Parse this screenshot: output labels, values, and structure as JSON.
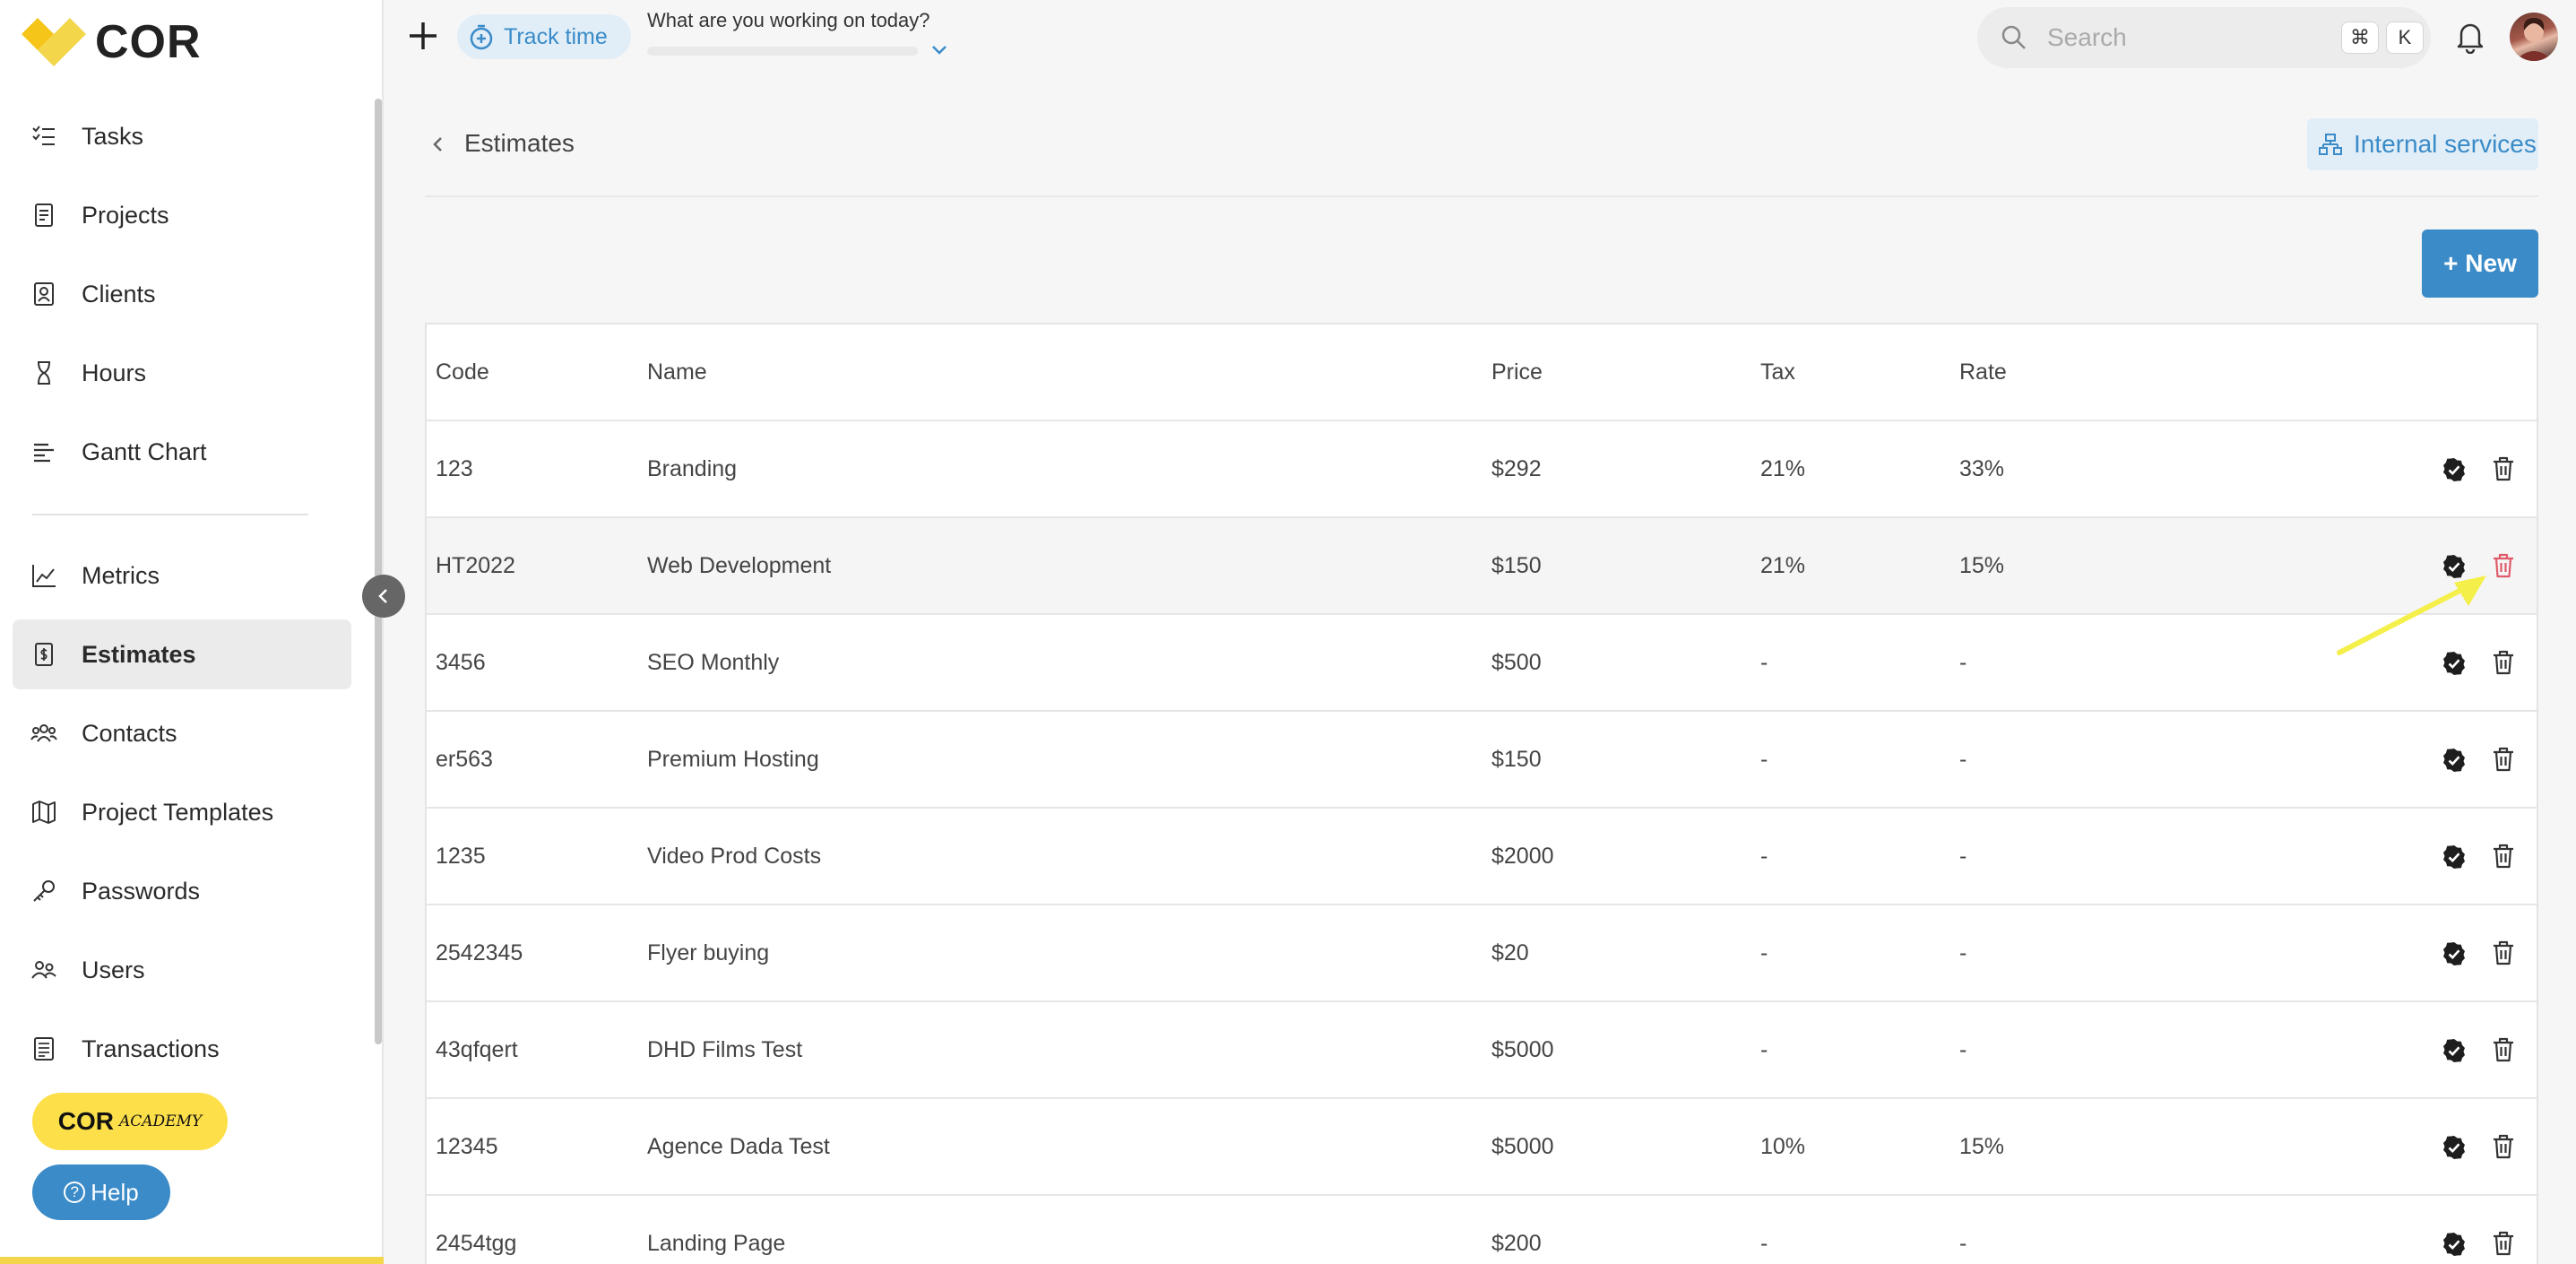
{
  "brand": {
    "logo_text": "COR"
  },
  "sidebar": {
    "items": [
      {
        "label": "Tasks",
        "icon": "tasks-icon"
      },
      {
        "label": "Projects",
        "icon": "projects-icon"
      },
      {
        "label": "Clients",
        "icon": "clients-icon"
      },
      {
        "label": "Hours",
        "icon": "hourglass-icon"
      },
      {
        "label": "Gantt Chart",
        "icon": "gantt-icon"
      },
      {
        "label": "Metrics",
        "icon": "metrics-icon"
      },
      {
        "label": "Estimates",
        "icon": "estimates-icon",
        "active": true
      },
      {
        "label": "Contacts",
        "icon": "contacts-icon"
      },
      {
        "label": "Project Templates",
        "icon": "map-icon"
      },
      {
        "label": "Passwords",
        "icon": "key-icon"
      },
      {
        "label": "Users",
        "icon": "users-icon"
      },
      {
        "label": "Transactions",
        "icon": "transactions-icon"
      }
    ],
    "academy": {
      "main": "COR",
      "sub": "ACADEMY"
    },
    "help_label": "Help"
  },
  "topbar": {
    "track_time_label": "Track time",
    "working_prompt": "What are you working on today?",
    "search_placeholder": "Search",
    "shortcut_keys": [
      "⌘",
      "K"
    ]
  },
  "page": {
    "title": "Estimates",
    "internal_services_label": "Internal services",
    "new_button_label": "+ New"
  },
  "table": {
    "columns": [
      "Code",
      "Name",
      "Price",
      "Tax",
      "Rate"
    ],
    "rows": [
      {
        "code": "123",
        "name": "Branding",
        "price": "$292",
        "tax": "21%",
        "rate": "33%"
      },
      {
        "code": "HT2022",
        "name": "Web Development",
        "price": "$150",
        "tax": "21%",
        "rate": "15%"
      },
      {
        "code": "3456",
        "name": "SEO Monthly",
        "price": "$500",
        "tax": "-",
        "rate": "-"
      },
      {
        "code": "er563",
        "name": "Premium Hosting",
        "price": "$150",
        "tax": "-",
        "rate": "-"
      },
      {
        "code": "1235",
        "name": "Video Prod Costs",
        "price": "$2000",
        "tax": "-",
        "rate": "-"
      },
      {
        "code": "2542345",
        "name": "Flyer buying",
        "price": "$20",
        "tax": "-",
        "rate": "-"
      },
      {
        "code": "43qfqert",
        "name": "DHD Films Test",
        "price": "$5000",
        "tax": "-",
        "rate": "-"
      },
      {
        "code": "12345",
        "name": "Agence Dada Test",
        "price": "$5000",
        "tax": "10%",
        "rate": "15%"
      },
      {
        "code": "2454tgg",
        "name": "Landing Page",
        "price": "$200",
        "tax": "-",
        "rate": "-"
      }
    ]
  },
  "colors": {
    "accent": "#3a8bc8",
    "accent_light": "#e1eef8",
    "brand_yellow": "#fddf4a",
    "trash_hover": "#e05a6a",
    "annotation_arrow": "#f5ef4a"
  }
}
